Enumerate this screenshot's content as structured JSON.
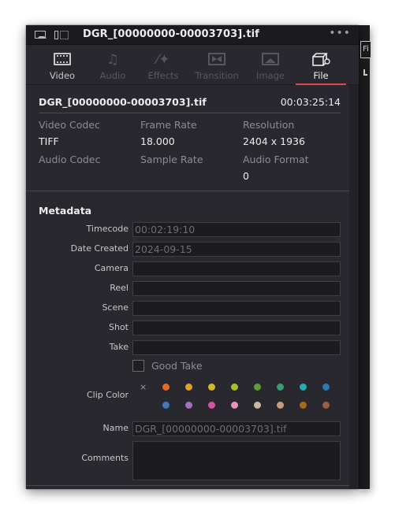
{
  "titlebar": {
    "title": "DGR_[00000000-00003703].tif",
    "menu": "•••"
  },
  "tabs": [
    {
      "label": "Video",
      "icon": "film-icon",
      "state": "enabled"
    },
    {
      "label": "Audio",
      "icon": "music-note-icon",
      "state": "disabled"
    },
    {
      "label": "Effects",
      "icon": "magic-wand-icon",
      "state": "disabled"
    },
    {
      "label": "Transition",
      "icon": "transition-icon",
      "state": "disabled"
    },
    {
      "label": "Image",
      "icon": "image-icon",
      "state": "disabled"
    },
    {
      "label": "File",
      "icon": "file-icon",
      "state": "active"
    }
  ],
  "file": {
    "name": "DGR_[00000000-00003703].tif",
    "duration": "00:03:25:14"
  },
  "info": {
    "video_codec_label": "Video Codec",
    "video_codec": "TIFF",
    "frame_rate_label": "Frame Rate",
    "frame_rate": "18.000",
    "resolution_label": "Resolution",
    "resolution": "2404 x 1936",
    "audio_codec_label": "Audio Codec",
    "sample_rate_label": "Sample Rate",
    "audio_format_label": "Audio Format",
    "audio_format": "0"
  },
  "metadata": {
    "title": "Metadata",
    "timecode_label": "Timecode",
    "timecode": "00:02:19:10",
    "date_created_label": "Date Created",
    "date_created": "2024-09-15",
    "camera_label": "Camera",
    "camera": "",
    "reel_label": "Reel",
    "reel": "",
    "scene_label": "Scene",
    "scene": "",
    "shot_label": "Shot",
    "shot": "",
    "take_label": "Take",
    "take": "",
    "good_take_label": "Good Take",
    "good_take_checked": false,
    "clip_color_label": "Clip Color",
    "clip_color_clear": "×",
    "clip_colors": [
      "#e36a2a",
      "#e0a030",
      "#d4b52c",
      "#a8c02c",
      "#5f9a3c",
      "#3e9a76",
      "#2aa7b5",
      "#2b78b5",
      "#4477b8",
      "#a56fbb",
      "#d552a2",
      "#e993b8",
      "#c9b99c",
      "#c89a78",
      "#a5681d",
      "#9a5c42"
    ],
    "name_label": "Name",
    "name": "DGR_[00000000-00003703].tif",
    "comments_label": "Comments",
    "comments": ""
  },
  "side": {
    "box_text": "Fi"
  }
}
